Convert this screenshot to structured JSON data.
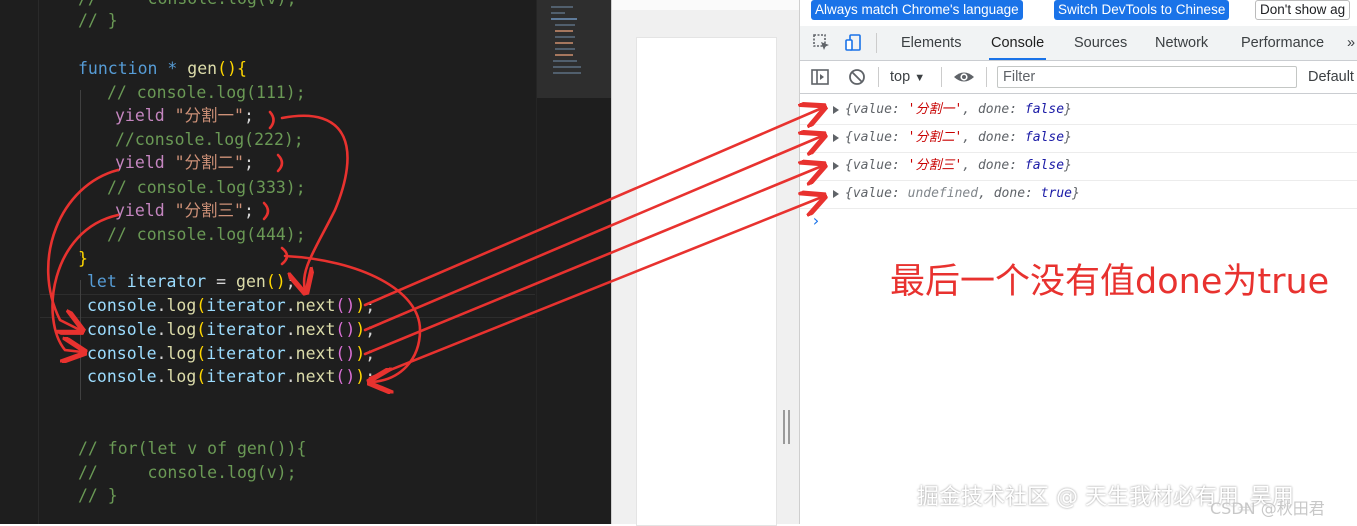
{
  "editor": {
    "code_lines": [
      {
        "key": "c0",
        "text": "//     console.log(v);"
      },
      {
        "key": "c1",
        "text": "// }"
      },
      {
        "key": "f_kw",
        "text": "function"
      },
      {
        "key": "f_star",
        "text": " * "
      },
      {
        "key": "f_name",
        "text": "gen"
      },
      {
        "key": "f_paren",
        "text": "(){"
      },
      {
        "key": "l111",
        "text": "// console.log(111);"
      },
      {
        "key": "y1_kw",
        "text": "yield"
      },
      {
        "key": "y1_str",
        "text": "\"分割一\""
      },
      {
        "key": "l222",
        "text": "//console.log(222);"
      },
      {
        "key": "y2_kw",
        "text": "yield"
      },
      {
        "key": "y2_str",
        "text": "\"分割二\""
      },
      {
        "key": "l333",
        "text": "// console.log(333);"
      },
      {
        "key": "y3_kw",
        "text": "yield"
      },
      {
        "key": "y3_str",
        "text": "\"分割三\""
      },
      {
        "key": "l444",
        "text": "// console.log(444);"
      },
      {
        "key": "close",
        "text": "}"
      },
      {
        "key": "let",
        "text": "let"
      },
      {
        "key": "iter_var",
        "text": "iterator"
      },
      {
        "key": "eq",
        "text": " = "
      },
      {
        "key": "gen_call",
        "text": "gen"
      },
      {
        "key": "semi",
        "text": ";"
      },
      {
        "key": "console",
        "text": "console"
      },
      {
        "key": "log",
        "text": "log"
      },
      {
        "key": "next",
        "text": "next"
      },
      {
        "key": "for1",
        "text": "// for(let v of gen()){"
      },
      {
        "key": "for2",
        "text": "//     console.log(v);"
      },
      {
        "key": "for3",
        "text": "// }"
      }
    ]
  },
  "devtools": {
    "infobar": {
      "btn1": "Always match Chrome's language",
      "btn2": "Switch DevTools to Chinese",
      "btn3": "Don't show ag"
    },
    "tabs": [
      "Elements",
      "Console",
      "Sources",
      "Network",
      "Performance"
    ],
    "active_tab": "Console",
    "toolbar": {
      "context": "top",
      "filter_placeholder": "Filter",
      "levels": "Default"
    },
    "messages": [
      {
        "value": "'分割一'",
        "done": "false"
      },
      {
        "value": "'分割二'",
        "done": "false"
      },
      {
        "value": "'分割三'",
        "done": "false"
      },
      {
        "value": "undefined",
        "done": "true"
      }
    ],
    "labels": {
      "value_key": "value:",
      "done_key": "done:",
      "open": "{",
      "close": "}",
      "comma": ", "
    },
    "prompt": "›"
  },
  "annotation": "最后一个没有值done为true",
  "watermark": "掘金技术社区 @ 天生我材必有用_吴用",
  "watermark2": "CSDN @秋田君",
  "colors": {
    "annotation_red": "#e8322f",
    "accent_blue": "#1a73e8"
  }
}
